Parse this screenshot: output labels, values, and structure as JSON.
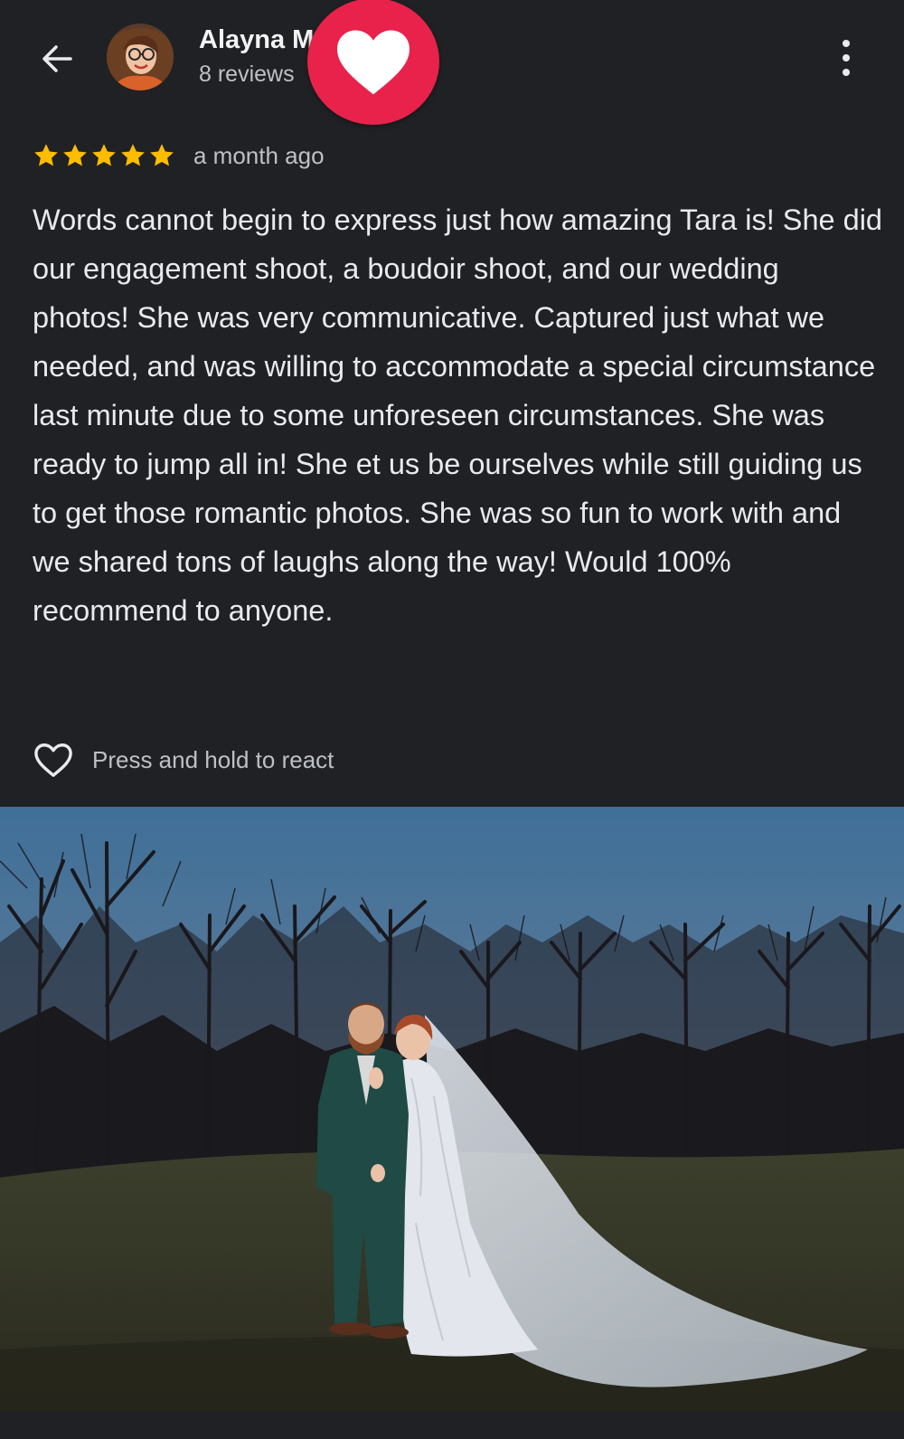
{
  "header": {
    "reviewer_name": "Alayna M",
    "review_count": "8 reviews",
    "back_icon": "arrow-left-icon",
    "more_icon": "more-vert-icon",
    "reaction_icon": "heart-icon"
  },
  "review": {
    "stars": 5,
    "date": "a month ago",
    "text": "Words cannot begin to express just how amazing Tara is! She did our engagement shoot, a boudoir shoot, and our wedding photos! She was very communicative. Captured just what we needed, and was willing to accommodate a special circumstance last minute due to some unforeseen circumstances. She was ready to jump all in! She et us be ourselves while still guiding us to get those romantic photos. She was so fun to work with and we shared tons of laughs along the way! Would 100% recommend to anyone."
  },
  "react": {
    "label": "Press and hold to react"
  },
  "colors": {
    "background": "#202124",
    "star": "#fbbc04",
    "reaction_bubble": "#e8224a"
  }
}
